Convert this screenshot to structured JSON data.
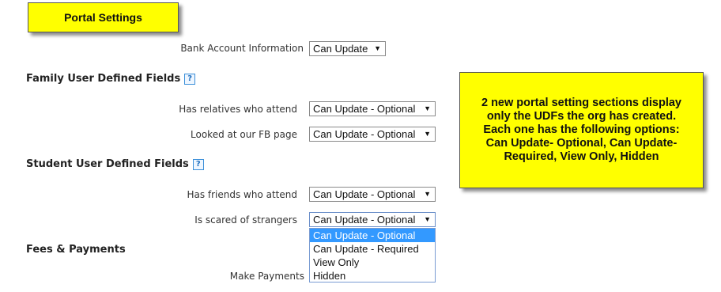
{
  "title_callout": {
    "text": "Portal Settings"
  },
  "note_callout": {
    "lines": [
      "2 new portal setting sections display",
      "only the UDFs the org has created.",
      "Each one has the following options:",
      "Can Update- Optional, Can Update-",
      "Required, View Only, Hidden"
    ]
  },
  "bank": {
    "label": "Bank Account Information",
    "value": "Can Update"
  },
  "family_udf": {
    "heading": "Family User Defined Fields",
    "help": "?",
    "fields": [
      {
        "label": "Has relatives who attend",
        "value": "Can Update - Optional"
      },
      {
        "label": "Looked at our FB page",
        "value": "Can Update - Optional"
      }
    ]
  },
  "student_udf": {
    "heading": "Student User Defined Fields",
    "help": "?",
    "fields": [
      {
        "label": "Has friends who attend",
        "value": "Can Update - Optional"
      },
      {
        "label": "Is scared of strangers",
        "value": "Can Update - Optional"
      }
    ]
  },
  "dropdown": {
    "options": [
      "Can Update - Optional",
      "Can Update - Required",
      "View Only",
      "Hidden"
    ],
    "selected_index": 0
  },
  "fees": {
    "heading": "Fees & Payments",
    "make_payments_label": "Make Payments"
  },
  "icons": {
    "select_arrow": "▼"
  },
  "colors": {
    "callout": "#ffff00",
    "selected_option": "#3399ff"
  }
}
